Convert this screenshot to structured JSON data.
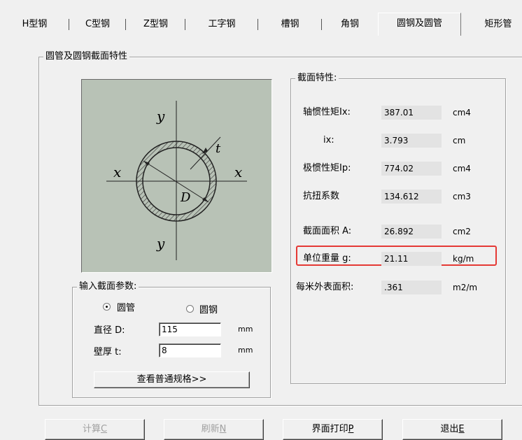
{
  "tabs": [
    {
      "label": "H型钢"
    },
    {
      "label": "C型钢"
    },
    {
      "label": "Z型钢"
    },
    {
      "label": "工字钢"
    },
    {
      "label": "槽钢"
    },
    {
      "label": "角钢"
    },
    {
      "label": "圆钢及圆管",
      "active": true
    },
    {
      "label": "矩形管"
    }
  ],
  "section_group": {
    "title": "圆管及圆钢截面特性"
  },
  "diagram": {
    "y_top": "y",
    "y_bottom": "y",
    "x_left": "x",
    "x_right": "x",
    "t": "t",
    "D": "D"
  },
  "properties": {
    "title": "截面特性:",
    "rows": [
      {
        "label": "轴惯性矩Ix:",
        "value": "387.01",
        "unit": "cm4"
      },
      {
        "label": "ix:",
        "value": "3.793",
        "unit": "cm"
      },
      {
        "label": "极惯性矩Ip:",
        "value": "774.02",
        "unit": "cm4"
      },
      {
        "label": "抗扭系数",
        "value": "134.612",
        "unit": "cm3"
      },
      {
        "label": "截面面积 A:",
        "value": "26.892",
        "unit": "cm2"
      },
      {
        "label": "单位重量 g:",
        "value": "21.11",
        "unit": "kg/m"
      },
      {
        "label": "每米外表面积:",
        "value": ".361",
        "unit": "m2/m"
      }
    ]
  },
  "input_params": {
    "title": "输入截面参数:",
    "radio_tube": "圆管",
    "radio_bar": "圆钢",
    "selected": "圆管",
    "diameter_label": "直径 D:",
    "diameter_value": "115",
    "diameter_unit": "mm",
    "thickness_label": "壁厚 t:",
    "thickness_value": "8",
    "thickness_unit": "mm",
    "spec_button": "查看普通规格>>"
  },
  "buttons": {
    "calc": {
      "text": "计算",
      "key": "C"
    },
    "refresh": {
      "text": "刷新",
      "key": "N"
    },
    "print": {
      "text": "界面打印",
      "key": "P"
    },
    "exit": {
      "text": "退出",
      "key": "E"
    }
  },
  "colors": {
    "highlight": "#e53935",
    "diagram_bg": "#b8c2b6"
  }
}
